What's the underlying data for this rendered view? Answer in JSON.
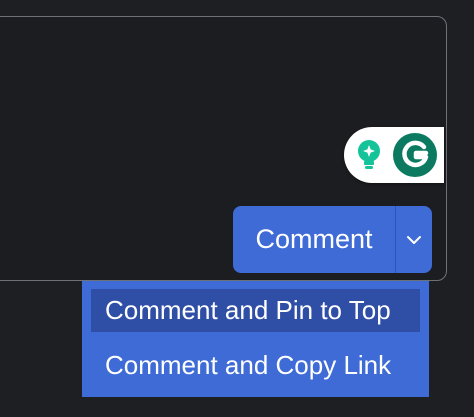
{
  "comment_button": {
    "label": "Comment"
  },
  "dropdown": {
    "items": [
      {
        "label": "Comment and Pin to Top",
        "highlighted": true
      },
      {
        "label": "Comment and Copy Link",
        "highlighted": false
      }
    ]
  },
  "grammarly": {
    "suggestion_icon": "lightbulb-icon",
    "logo_icon": "grammarly-logo-icon"
  },
  "colors": {
    "background": "#1e1f22",
    "accent": "#3f6bd6",
    "highlight": "#2f4ea6",
    "grammarly_green": "#15c39a",
    "grammarly_teal": "#0b7a60"
  }
}
